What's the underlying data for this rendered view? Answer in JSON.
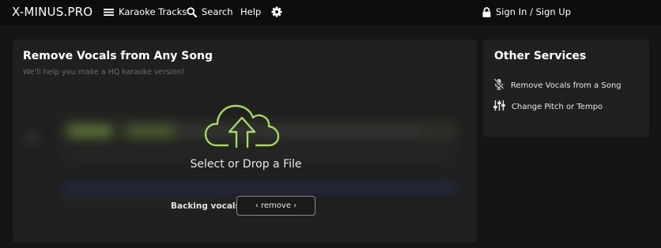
{
  "header": {
    "brand": "X-MINUS.PRO",
    "nav": {
      "karaoke_tracks": "Karaoke Tracks",
      "search": "Search",
      "help": "Help",
      "sign_in": "Sign In / Sign Up"
    },
    "icons": {
      "menu": "hamburger-icon",
      "search": "search-icon",
      "settings": "gear-icon",
      "lock": "lock-icon"
    }
  },
  "main": {
    "title": "Remove Vocals from Any Song",
    "subtitle": "We'll help you make a HQ karaoke version!",
    "dropzone": {
      "icon": "cloud-upload-icon",
      "label": "Select or Drop a File"
    },
    "backing_vocals": {
      "label": "Backing vocals",
      "selected": "‹ remove ›"
    }
  },
  "sidebar": {
    "title": "Other Services",
    "links": [
      {
        "label": "Remove Vocals from a Song",
        "icon": "mic-off-icon"
      },
      {
        "label": "Change Pitch or Tempo",
        "icon": "sliders-icon"
      }
    ]
  },
  "colors": {
    "accent": "#a6d864",
    "background": "#151515",
    "card": "#202020",
    "topbar": "#0d0d0d"
  }
}
